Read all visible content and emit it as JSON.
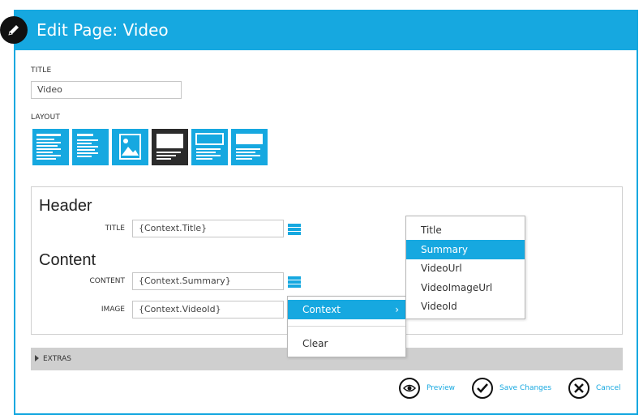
{
  "dialog": {
    "title": "Edit Page: Video",
    "accent_color": "#16a8e0"
  },
  "page_form": {
    "title_label": "TITLE",
    "title_value": "Video",
    "layout_label": "LAYOUT",
    "layouts": [
      {
        "icon": "text-layout-icon",
        "selected": false
      },
      {
        "icon": "text-layout-icon",
        "selected": false
      },
      {
        "icon": "image-layout-icon",
        "selected": false
      },
      {
        "icon": "video-layout-icon",
        "selected": true
      },
      {
        "icon": "header-layout-icon",
        "selected": false
      },
      {
        "icon": "header-layout-icon",
        "selected": false
      }
    ]
  },
  "header_section": {
    "heading": "Header",
    "title_field": {
      "label": "TITLE",
      "value": "{Context.Title}"
    }
  },
  "content_section": {
    "heading": "Content",
    "content_field": {
      "label": "CONTENT",
      "value": "{Context.Summary}"
    },
    "image_field": {
      "label": "IMAGE",
      "value": "{Context.VideoId}"
    }
  },
  "context_menu": {
    "items": [
      "Context",
      "Clear"
    ],
    "submenu_arrow": "›"
  },
  "submenu": {
    "items": [
      "Title",
      "Summary",
      "VideoUrl",
      "VideoImageUrl",
      "VideoId"
    ],
    "highlighted": "Summary"
  },
  "extras": {
    "label": "EXTRAS"
  },
  "actions": {
    "preview": "Preview",
    "save": "Save Changes",
    "cancel": "Cancel"
  }
}
